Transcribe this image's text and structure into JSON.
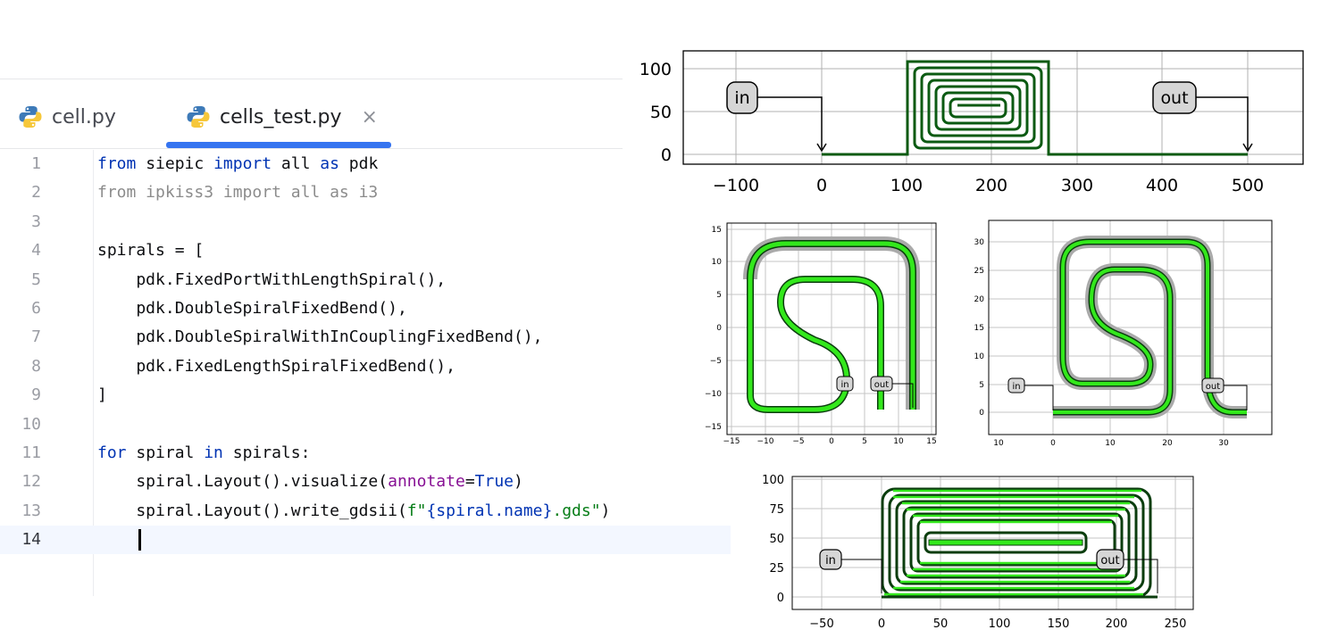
{
  "tabs": [
    {
      "label": "cell.py",
      "active": false
    },
    {
      "label": "cells_test.py",
      "active": true
    }
  ],
  "close_glyph": "×",
  "code_lines": [
    {
      "n": "1",
      "parts": [
        {
          "t": "from",
          "c": "kw"
        },
        {
          "t": " siepic "
        },
        {
          "t": "import",
          "c": "kw"
        },
        {
          "t": " all "
        },
        {
          "t": "as",
          "c": "kw"
        },
        {
          "t": " pdk"
        }
      ]
    },
    {
      "n": "2",
      "parts": [
        {
          "t": "from ipkiss3 import all as i3",
          "c": "cmt"
        }
      ]
    },
    {
      "n": "3",
      "parts": []
    },
    {
      "n": "4",
      "parts": [
        {
          "t": "spirals = ["
        }
      ]
    },
    {
      "n": "5",
      "parts": [
        {
          "t": "    pdk.FixedPortWithLengthSpiral(),"
        }
      ]
    },
    {
      "n": "6",
      "parts": [
        {
          "t": "    pdk.DoubleSpiralFixedBend(),"
        }
      ]
    },
    {
      "n": "7",
      "parts": [
        {
          "t": "    pdk.DoubleSpiralWithInCouplingFixedBend(),"
        }
      ]
    },
    {
      "n": "8",
      "parts": [
        {
          "t": "    pdk.FixedLengthSpiralFixedBend(),"
        }
      ]
    },
    {
      "n": "9",
      "parts": [
        {
          "t": "]"
        }
      ]
    },
    {
      "n": "10",
      "parts": []
    },
    {
      "n": "11",
      "parts": [
        {
          "t": "for",
          "c": "kw"
        },
        {
          "t": " spiral "
        },
        {
          "t": "in",
          "c": "kw"
        },
        {
          "t": " spirals:"
        }
      ]
    },
    {
      "n": "12",
      "parts": [
        {
          "t": "    spiral.Layout().visualize("
        },
        {
          "t": "annotate",
          "c": "param"
        },
        {
          "t": "="
        },
        {
          "t": "True",
          "c": "kw"
        },
        {
          "t": ")"
        }
      ]
    },
    {
      "n": "13",
      "parts": [
        {
          "t": "    spiral.Layout().write_gdsii("
        },
        {
          "t": "f\"",
          "c": "str"
        },
        {
          "t": "{spiral.name}",
          "c": "kw"
        },
        {
          "t": ".gds\"",
          "c": "str"
        },
        {
          "t": ")"
        }
      ]
    },
    {
      "n": "14",
      "parts": [],
      "current": true
    }
  ],
  "plots": {
    "p1": {
      "xticks": [
        "−100",
        "0",
        "100",
        "200",
        "300",
        "400",
        "500"
      ],
      "yticks": [
        "0",
        "50",
        "100"
      ],
      "in": "in",
      "out": "out"
    },
    "p2": {
      "xticks": [
        "−15",
        "−10",
        "−5",
        "0",
        "5",
        "10",
        "15"
      ],
      "yticks": [
        "−15",
        "−10",
        "−5",
        "0",
        "5",
        "10",
        "15"
      ],
      "in": "in",
      "out": "out"
    },
    "p3": {
      "xticks": [
        "10",
        "0",
        "10",
        "20",
        "30"
      ],
      "yticks": [
        "0",
        "5",
        "10",
        "15",
        "20",
        "25",
        "30"
      ],
      "in": "in",
      "out": "out"
    },
    "p4": {
      "xticks": [
        "−50",
        "0",
        "50",
        "100",
        "150",
        "200",
        "250"
      ],
      "yticks": [
        "0",
        "25",
        "50",
        "75",
        "100"
      ],
      "in": "in",
      "out": "out"
    }
  }
}
